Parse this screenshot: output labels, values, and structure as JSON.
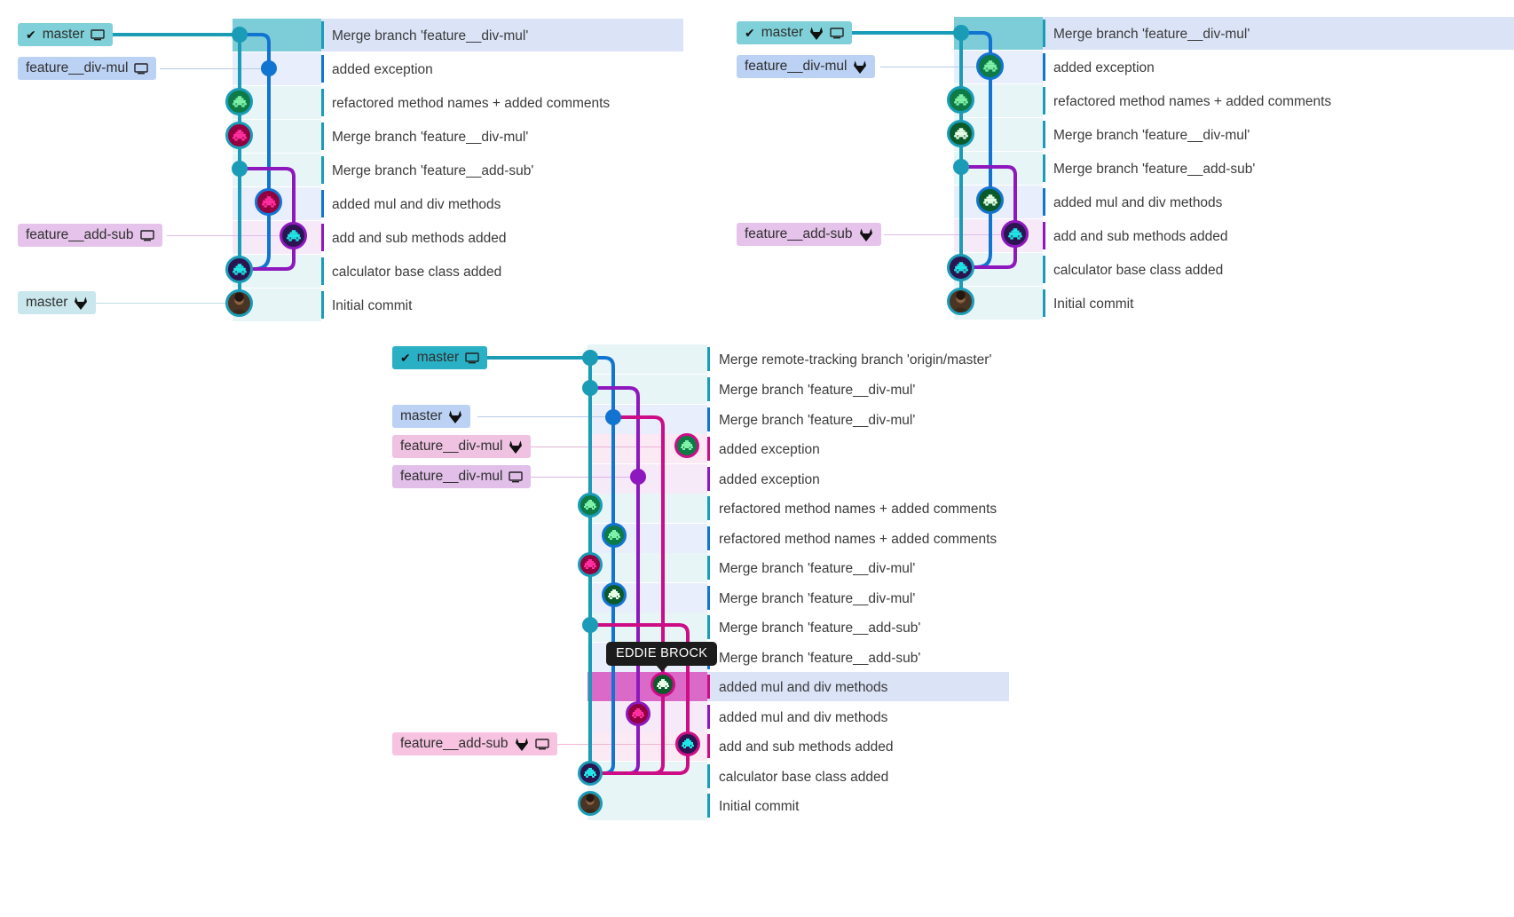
{
  "app": {
    "title": "Git Graph Commit Log",
    "tooltip": {
      "text": "EDDIE BROCK"
    }
  },
  "colors": {
    "teal": "#1a9cb7",
    "blue": "#1274d1",
    "purple": "#8d18bd",
    "magenta": "#cc0d86",
    "label_master_current": "#7fd0d8",
    "label_blue": "#bcd2f5",
    "label_purple": "#e5c3ea",
    "label_pink": "#f7c3e0",
    "row_teal": "#e8f5f7",
    "row_blue": "#e8eefc",
    "row_purple": "#f6eaf9",
    "row_pink": "#fbe9f3",
    "row_selected": "#dbe3f7",
    "head_row": "#7ccdd8",
    "tooltip_bg": "#1c1c1c"
  },
  "panels": [
    {
      "id": "panel-left",
      "name": "local-only-graph",
      "labels": [
        {
          "text": "master",
          "icons": [
            "check",
            "desktop"
          ],
          "style": "current",
          "row": 0
        },
        {
          "text": "feature__div-mul",
          "icons": [
            "desktop"
          ],
          "style": "blue",
          "row": 1
        },
        {
          "text": "feature__add-sub",
          "icons": [
            "desktop"
          ],
          "style": "purple",
          "row": 6
        },
        {
          "text": "master",
          "icons": [
            "gitlab"
          ],
          "style": "teal-soft",
          "row": 8
        }
      ],
      "rows": [
        {
          "message": "Merge branch 'feature__div-mul'",
          "bar": "teal",
          "bg": "head",
          "selected": true
        },
        {
          "message": "added exception",
          "bar": "blue",
          "bg": "blue"
        },
        {
          "message": "refactored method names + added comments",
          "bar": "teal",
          "bg": "teal"
        },
        {
          "message": "Merge branch 'feature__div-mul'",
          "bar": "teal",
          "bg": "teal"
        },
        {
          "message": "Merge branch 'feature__add-sub'",
          "bar": "teal",
          "bg": "teal"
        },
        {
          "message": "added mul and div methods",
          "bar": "blue",
          "bg": "blue"
        },
        {
          "message": "add and sub methods added",
          "bar": "purple",
          "bg": "purple"
        },
        {
          "message": "calculator base class added",
          "bar": "teal",
          "bg": "teal"
        },
        {
          "message": "Initial commit",
          "bar": "teal",
          "bg": "teal"
        }
      ]
    },
    {
      "id": "panel-right",
      "name": "remote-tracking-graph",
      "labels": [
        {
          "text": "master",
          "icons": [
            "check",
            "gitlab",
            "desktop"
          ],
          "style": "current",
          "row": 0
        },
        {
          "text": "feature__div-mul",
          "icons": [
            "gitlab"
          ],
          "style": "blue",
          "row": 1
        },
        {
          "text": "feature__add-sub",
          "icons": [
            "gitlab"
          ],
          "style": "purple",
          "row": 6
        }
      ],
      "rows": [
        {
          "message": "Merge branch 'feature__div-mul'",
          "bar": "teal",
          "bg": "head",
          "selected": true
        },
        {
          "message": "added exception",
          "bar": "blue",
          "bg": "blue"
        },
        {
          "message": "refactored method names + added comments",
          "bar": "teal",
          "bg": "teal"
        },
        {
          "message": "Merge branch 'feature__div-mul'",
          "bar": "teal",
          "bg": "teal"
        },
        {
          "message": "Merge branch 'feature__add-sub'",
          "bar": "teal",
          "bg": "teal"
        },
        {
          "message": "added mul and div methods",
          "bar": "blue",
          "bg": "blue"
        },
        {
          "message": "add and sub methods added",
          "bar": "purple",
          "bg": "purple"
        },
        {
          "message": "calculator base class added",
          "bar": "teal",
          "bg": "teal"
        },
        {
          "message": "Initial commit",
          "bar": "teal",
          "bg": "teal"
        }
      ]
    },
    {
      "id": "panel-bottom",
      "name": "merged-local-and-remote-graph",
      "labels": [
        {
          "text": "master",
          "icons": [
            "check",
            "desktop"
          ],
          "style": "current",
          "row": 0
        },
        {
          "text": "master",
          "icons": [
            "gitlab"
          ],
          "style": "blue",
          "row": 2
        },
        {
          "text": "feature__div-mul",
          "icons": [
            "gitlab"
          ],
          "style": "pink",
          "row": 3
        },
        {
          "text": "feature__div-mul",
          "icons": [
            "desktop"
          ],
          "style": "purple",
          "row": 4
        },
        {
          "text": "feature__add-sub",
          "icons": [
            "gitlab",
            "desktop"
          ],
          "style": "pink",
          "row": 13
        }
      ],
      "rows": [
        {
          "message": "Merge remote-tracking branch 'origin/master'",
          "bar": "teal",
          "bg": "teal"
        },
        {
          "message": "Merge branch 'feature__div-mul'",
          "bar": "teal",
          "bg": "teal"
        },
        {
          "message": "Merge branch 'feature__div-mul'",
          "bar": "blue",
          "bg": "blue"
        },
        {
          "message": "added exception",
          "bar": "magenta",
          "bg": "pink"
        },
        {
          "message": "added exception",
          "bar": "purple",
          "bg": "purple"
        },
        {
          "message": "refactored method names + added comments",
          "bar": "teal",
          "bg": "teal"
        },
        {
          "message": "refactored method names + added comments",
          "bar": "blue",
          "bg": "blue"
        },
        {
          "message": "Merge branch 'feature__div-mul'",
          "bar": "teal",
          "bg": "teal"
        },
        {
          "message": "Merge branch 'feature__div-mul'",
          "bar": "blue",
          "bg": "blue"
        },
        {
          "message": "Merge branch 'feature__add-sub'",
          "bar": "teal",
          "bg": "teal"
        },
        {
          "message": "Merge branch 'feature__add-sub'",
          "bar": "blue",
          "bg": "blue"
        },
        {
          "message": "added mul and div methods",
          "bar": "magenta",
          "bg": "magenta-strong",
          "selected": true
        },
        {
          "message": "added mul and div methods",
          "bar": "purple",
          "bg": "purple"
        },
        {
          "message": "add and sub methods added",
          "bar": "magenta",
          "bg": "pink"
        },
        {
          "message": "calculator base class added",
          "bar": "teal",
          "bg": "teal"
        },
        {
          "message": "Initial commit",
          "bar": "teal",
          "bg": "teal"
        }
      ]
    }
  ]
}
